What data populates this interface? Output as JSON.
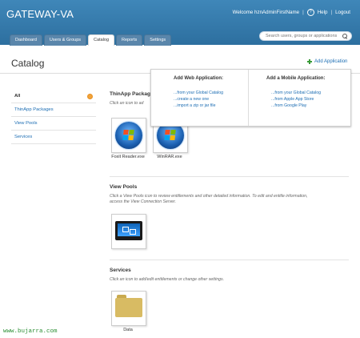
{
  "header": {
    "brand": "GATEWAY-VA",
    "welcome": "Welcome hznAdminFirstName",
    "sep": "|",
    "help_glyph": "?",
    "help": "Help",
    "logout": "Logout"
  },
  "tabs": [
    {
      "label": "Dashboard"
    },
    {
      "label": "Users & Groups"
    },
    {
      "label": "Catalog"
    },
    {
      "label": "Reports"
    },
    {
      "label": "Settings"
    }
  ],
  "search": {
    "placeholder": "Search users, groups or applications"
  },
  "page": {
    "title": "Catalog",
    "add_app": "Add Application"
  },
  "dropdown": {
    "web": {
      "heading": "Add Web Application:",
      "links": [
        "...from your Global Catalog",
        "...create a new one",
        "...import a zip or jar file"
      ]
    },
    "mobile": {
      "heading": "Add a Mobile Application:",
      "links": [
        "...from your Global Catalog",
        "...from Apple App Store",
        "...from Google Play"
      ]
    }
  },
  "sidebar": {
    "items": [
      {
        "label": "All"
      },
      {
        "label": "ThinApp Packages"
      },
      {
        "label": "View Pools"
      },
      {
        "label": "Services"
      }
    ]
  },
  "sections": {
    "thinapp": {
      "title": "ThinApp Packag",
      "desc": "Click an icon to ad",
      "tiles": [
        {
          "label": "Foxit Reader.exe"
        },
        {
          "label": "WinRAR.exe"
        }
      ]
    },
    "viewpools": {
      "title": "View Pools",
      "desc1": "Click a View Pools icon to review entitlements and other detailed information. To edit and entitle information,",
      "desc2": "access the View Connection Server."
    },
    "services": {
      "title": "Services",
      "desc": "Click an icon to add/edit entitlements or change other settings.",
      "tiles": [
        {
          "label": "Data"
        }
      ]
    }
  },
  "watermark": "www.bujarra.com",
  "colors": {
    "header": "#3f87b9",
    "link": "#1c6db3",
    "plus": "#3a9b39",
    "watermark": "#2b8f34"
  }
}
